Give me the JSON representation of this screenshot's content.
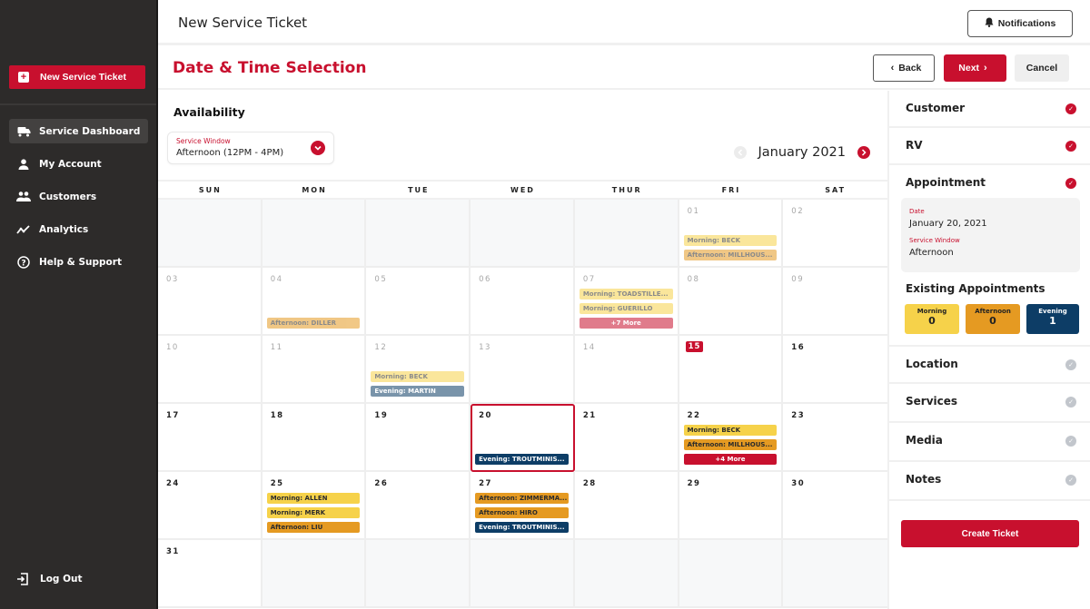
{
  "sidebar": {
    "new_ticket_label": "New Service Ticket",
    "nav": [
      {
        "label": "Service Dashboard",
        "icon": "truck-icon",
        "active": true
      },
      {
        "label": "My Account",
        "icon": "user-icon",
        "active": false
      },
      {
        "label": "Customers",
        "icon": "users-icon",
        "active": false
      },
      {
        "label": "Analytics",
        "icon": "chart-line-icon",
        "active": false
      },
      {
        "label": "Help & Support",
        "icon": "help-circle-icon",
        "active": false
      }
    ],
    "logout_label": "Log Out"
  },
  "header": {
    "title": "New Service Ticket",
    "notifications_label": "Notifications"
  },
  "stepbar": {
    "title": "Date & Time Selection",
    "back_label": "Back",
    "next_label": "Next",
    "cancel_label": "Cancel"
  },
  "availability": {
    "title": "Availability",
    "service_window_label": "Service Window",
    "service_window_value": "Afternoon (12PM - 4PM)"
  },
  "calendar": {
    "month_label": "January 2021",
    "weekdays": [
      "SUN",
      "MON",
      "TUE",
      "WED",
      "THUR",
      "FRI",
      "SAT"
    ],
    "today": 15,
    "selected": 20,
    "leading_blanks": 5,
    "days_in_month": 31,
    "events": {
      "1": [
        {
          "type": "morning",
          "text": "Morning: BECK"
        },
        {
          "type": "afternoon",
          "text": "Afternoon: MILLHOUS..."
        }
      ],
      "4": [
        {
          "type": "afternoon",
          "text": "Afternoon: DILLER"
        }
      ],
      "7": [
        {
          "type": "morning",
          "text": "Morning: TOADSTILLE..."
        },
        {
          "type": "morning",
          "text": "Morning: GUERILLO"
        },
        {
          "type": "more",
          "text": "+7 More"
        }
      ],
      "12": [
        {
          "type": "morning",
          "text": "Morning: BECK"
        },
        {
          "type": "evening",
          "text": "Evening: MARTIN"
        }
      ],
      "20": [
        {
          "type": "evening",
          "text": "Evening: TROUTMINIS..."
        }
      ],
      "22": [
        {
          "type": "morning",
          "text": "Morning: BECK"
        },
        {
          "type": "afternoon",
          "text": "Afternoon: MILLHOUS..."
        },
        {
          "type": "more",
          "text": "+4 More"
        }
      ],
      "25": [
        {
          "type": "morning",
          "text": "Morning: ALLEN"
        },
        {
          "type": "morning",
          "text": "Morning: MERK"
        },
        {
          "type": "afternoon",
          "text": "Afternoon: LIU"
        }
      ],
      "27": [
        {
          "type": "afternoon",
          "text": "Afternoon: ZIMMERMA..."
        },
        {
          "type": "afternoon",
          "text": "Afternoon: HIRO"
        },
        {
          "type": "evening",
          "text": "Evening: TROUTMINIS..."
        }
      ]
    }
  },
  "summary": {
    "sections_top": [
      {
        "label": "Customer",
        "complete": true
      },
      {
        "label": "RV",
        "complete": true
      },
      {
        "label": "Appointment",
        "complete": true
      }
    ],
    "appointment": {
      "date_label": "Date",
      "date_value": "January 20, 2021",
      "window_label": "Service Window",
      "window_value": "Afternoon"
    },
    "existing": {
      "title": "Existing Appointments",
      "morning_label": "Morning",
      "morning_count": "0",
      "afternoon_label": "Afternoon",
      "afternoon_count": "0",
      "evening_label": "Evening",
      "evening_count": "1"
    },
    "sections_bottom": [
      {
        "label": "Location",
        "complete": false
      },
      {
        "label": "Services",
        "complete": false
      },
      {
        "label": "Media",
        "complete": false
      },
      {
        "label": "Notes",
        "complete": false
      }
    ],
    "create_label": "Create Ticket"
  },
  "colors": {
    "brand_red": "#c8102e",
    "morning": "#f6d24a",
    "afternoon": "#e59a22",
    "evening": "#0d3d66",
    "sidebar_bg": "#2d2b2a"
  }
}
